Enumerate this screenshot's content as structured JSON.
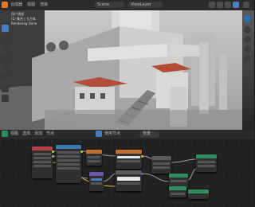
{
  "header": {
    "menu_label": "合成器",
    "view_label": "视图",
    "render_label": "渲染",
    "scene_name": "Scene",
    "view_layer": "ViewLayer"
  },
  "viewport": {
    "overlay_lines": [
      "用户透视",
      "(1) 集合 | 立方体",
      "Rendering Done"
    ]
  },
  "node_editor": {
    "header_labels": [
      "视图",
      "选择",
      "添加",
      "节点"
    ],
    "use_nodes_label": "使用节点",
    "backdrop_label": "背景",
    "nodes": [
      {
        "id": "render-layers",
        "title": "渲染层",
        "color": "#b04349"
      },
      {
        "id": "mix-1",
        "title": "混合",
        "color": "#3b7ab0"
      },
      {
        "id": "blur",
        "title": "模糊",
        "color": "#6c5aa8"
      },
      {
        "id": "glare",
        "title": "辉光",
        "color": "#c27131"
      },
      {
        "id": "color-balance",
        "title": "色彩平衡",
        "color": "#c27131"
      },
      {
        "id": "rgb-curves",
        "title": "RGB 曲线",
        "color": "#5b5b5b"
      },
      {
        "id": "composite",
        "title": "合成",
        "color": "#5b5b5b"
      },
      {
        "id": "viewer",
        "title": "查看器",
        "color": "#5b5b5b"
      },
      {
        "id": "mix-2",
        "title": "混合",
        "color": "#2f8d64"
      },
      {
        "id": "gamma",
        "title": "伽玛",
        "color": "#2f8d64"
      },
      {
        "id": "output",
        "title": "文件输出",
        "color": "#2f8d64"
      }
    ]
  },
  "colors": {
    "accent": "#4a7ec2",
    "link": "#9a9a9a",
    "socket_yellow": "#c7c729",
    "socket_gray": "#a1a1a1",
    "socket_blue": "#6363c7"
  }
}
